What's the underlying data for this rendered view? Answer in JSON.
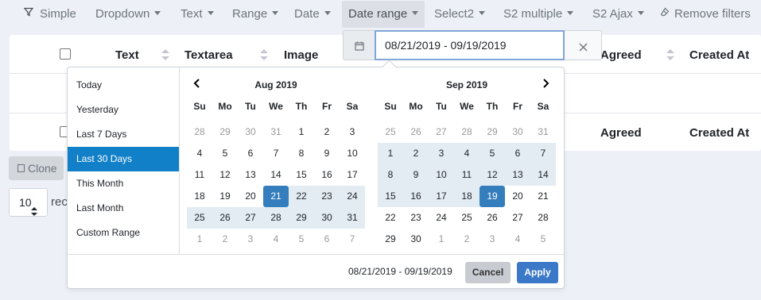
{
  "toolbar": {
    "simple": "Simple",
    "dropdown": "Dropdown",
    "text": "Text",
    "range": "Range",
    "date": "Date",
    "date_range": "Date range",
    "select2": "Select2",
    "s2_multiple": "S2 multiple",
    "s2_ajax": "S2 Ajax",
    "remove_filters": "Remove filters"
  },
  "table": {
    "headers": {
      "text": "Text",
      "textarea": "Textarea",
      "image": "Image",
      "agreed": "Agreed",
      "created_at": "Created At"
    }
  },
  "actions": {
    "clone": "Clone",
    "per_page_value": "10",
    "records_text": "rec"
  },
  "daterange_input": {
    "value": "08/21/2019 - 09/19/2019"
  },
  "picker": {
    "ranges": [
      "Today",
      "Yesterday",
      "Last 7 Days",
      "Last 30 Days",
      "This Month",
      "Last Month",
      "Custom Range"
    ],
    "active_range_index": 3,
    "weekdays": [
      "Su",
      "Mo",
      "Tu",
      "We",
      "Th",
      "Fr",
      "Sa"
    ],
    "calendars": [
      {
        "month": "Aug 2019",
        "weeks": [
          [
            [
              "28",
              "off"
            ],
            [
              "29",
              "off"
            ],
            [
              "30",
              "off"
            ],
            [
              "31",
              "off"
            ],
            [
              "1",
              ""
            ],
            [
              "2",
              ""
            ],
            [
              "3",
              ""
            ]
          ],
          [
            [
              "4",
              ""
            ],
            [
              "5",
              ""
            ],
            [
              "6",
              ""
            ],
            [
              "7",
              ""
            ],
            [
              "8",
              ""
            ],
            [
              "9",
              ""
            ],
            [
              "10",
              ""
            ]
          ],
          [
            [
              "11",
              ""
            ],
            [
              "12",
              ""
            ],
            [
              "13",
              ""
            ],
            [
              "14",
              ""
            ],
            [
              "15",
              ""
            ],
            [
              "16",
              ""
            ],
            [
              "17",
              ""
            ]
          ],
          [
            [
              "18",
              ""
            ],
            [
              "19",
              ""
            ],
            [
              "20",
              ""
            ],
            [
              "21",
              "endpt"
            ],
            [
              "22",
              "inrange"
            ],
            [
              "23",
              "inrange"
            ],
            [
              "24",
              "inrange"
            ]
          ],
          [
            [
              "25",
              "inrange"
            ],
            [
              "26",
              "inrange"
            ],
            [
              "27",
              "inrange"
            ],
            [
              "28",
              "inrange"
            ],
            [
              "29",
              "inrange"
            ],
            [
              "30",
              "inrange"
            ],
            [
              "31",
              "inrange"
            ]
          ],
          [
            [
              "1",
              "off"
            ],
            [
              "2",
              "off"
            ],
            [
              "3",
              "off"
            ],
            [
              "4",
              "off"
            ],
            [
              "5",
              "off"
            ],
            [
              "6",
              "off"
            ],
            [
              "7",
              "off"
            ]
          ]
        ]
      },
      {
        "month": "Sep 2019",
        "weeks": [
          [
            [
              "25",
              "off"
            ],
            [
              "26",
              "off"
            ],
            [
              "27",
              "off"
            ],
            [
              "28",
              "off"
            ],
            [
              "29",
              "off"
            ],
            [
              "30",
              "off"
            ],
            [
              "31",
              "off"
            ]
          ],
          [
            [
              "1",
              "inrange"
            ],
            [
              "2",
              "inrange"
            ],
            [
              "3",
              "inrange"
            ],
            [
              "4",
              "inrange"
            ],
            [
              "5",
              "inrange"
            ],
            [
              "6",
              "inrange"
            ],
            [
              "7",
              "inrange"
            ]
          ],
          [
            [
              "8",
              "inrange"
            ],
            [
              "9",
              "inrange"
            ],
            [
              "10",
              "inrange"
            ],
            [
              "11",
              "inrange"
            ],
            [
              "12",
              "inrange"
            ],
            [
              "13",
              "inrange"
            ],
            [
              "14",
              "inrange"
            ]
          ],
          [
            [
              "15",
              "inrange"
            ],
            [
              "16",
              "inrange"
            ],
            [
              "17",
              "inrange"
            ],
            [
              "18",
              "inrange"
            ],
            [
              "19",
              "endpt"
            ],
            [
              "20",
              ""
            ],
            [
              "21",
              ""
            ]
          ],
          [
            [
              "22",
              ""
            ],
            [
              "23",
              ""
            ],
            [
              "24",
              ""
            ],
            [
              "25",
              ""
            ],
            [
              "26",
              ""
            ],
            [
              "27",
              ""
            ],
            [
              "28",
              ""
            ]
          ],
          [
            [
              "29",
              ""
            ],
            [
              "30",
              ""
            ],
            [
              "1",
              "off"
            ],
            [
              "2",
              "off"
            ],
            [
              "3",
              "off"
            ],
            [
              "4",
              "off"
            ],
            [
              "5",
              "off"
            ]
          ]
        ]
      }
    ],
    "selected_range_text": "08/21/2019 - 09/19/2019",
    "cancel_label": "Cancel",
    "apply_label": "Apply"
  },
  "colors": {
    "active_range": "#1180c8",
    "selected_day": "#357ebd",
    "in_range_day": "#e3ecf3",
    "apply_button": "#3b78c7"
  }
}
